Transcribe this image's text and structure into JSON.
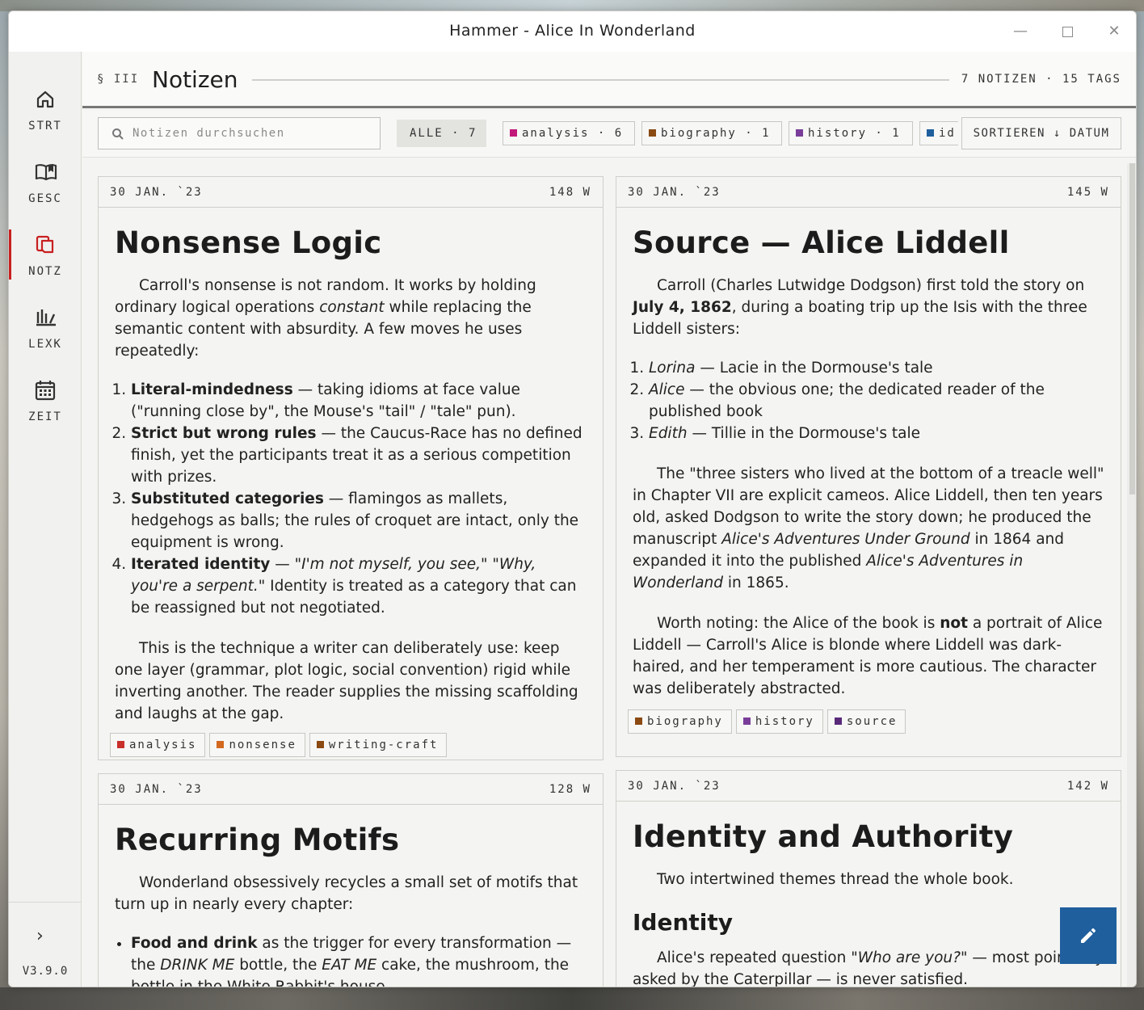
{
  "window": {
    "title": "Hammer - Alice In Wonderland"
  },
  "sidebar": {
    "items": [
      {
        "label": "STRT",
        "icon": "home-icon"
      },
      {
        "label": "GESC",
        "icon": "book-icon"
      },
      {
        "label": "NOTZ",
        "icon": "notes-icon",
        "active": true
      },
      {
        "label": "LEXK",
        "icon": "library-icon"
      },
      {
        "label": "ZEIT",
        "icon": "calendar-icon"
      }
    ],
    "version": "V3.9.0"
  },
  "header": {
    "section": "§ III",
    "title": "Notizen",
    "count": "7 NOTIZEN · 15 TAGS"
  },
  "toolbar": {
    "search_placeholder": "Notizen durchsuchen",
    "filters": [
      {
        "label": "ALLE · 7"
      },
      {
        "label": "analysis · 6",
        "color": "#c2187a"
      },
      {
        "label": "biography · 1",
        "color": "#8a4a12"
      },
      {
        "label": "history · 1",
        "color": "#7a3e9a"
      },
      {
        "label": "id",
        "color": "#1f5f9e"
      }
    ],
    "sort_label": "SORTIEREN ↓ DATUM"
  },
  "notes": [
    {
      "date": "30 JAN. `23",
      "words": "148 W",
      "title": "Nonsense Logic",
      "p1_a": "Carroll's nonsense is not random. It works by holding ordinary logical operations ",
      "p1_em": "constant",
      "p1_b": " while replacing the semantic content with absurdity. A few moves he uses repeatedly:",
      "list": [
        {
          "strong": "Literal-mindedness",
          "text": " — taking idioms at face value (\"running close by\", the Mouse's \"tail\" / \"tale\" pun)."
        },
        {
          "strong": "Strict but wrong rules",
          "text": " — the Caucus-Race has no defined finish, yet the participants treat it as a serious competition with prizes."
        },
        {
          "strong": "Substituted categories",
          "text": " — flamingos as mallets, hedgehogs as balls; the rules of croquet are intact, only the equipment is wrong."
        },
        {
          "strong": "Iterated identity",
          "text_a": " — \"",
          "em": "I'm not myself, you see,",
          "text_b": "\" \"",
          "em2": "Why, you're a serpent.",
          "text_c": "\" Identity is treated as a category that can be reassigned but not negotiated."
        }
      ],
      "p2": "This is the technique a writer can deliberately use: keep one layer (grammar, plot logic, social convention) rigid while inverting another. The reader supplies the missing scaffolding and laughs at the gap.",
      "tags": [
        {
          "label": "analysis",
          "color": "#c8302a"
        },
        {
          "label": "nonsense",
          "color": "#d2691e"
        },
        {
          "label": "writing-craft",
          "color": "#8a4a12"
        }
      ]
    },
    {
      "date": "30 JAN. `23",
      "words": "145 W",
      "title": "Source — Alice Liddell",
      "p1_a": "Carroll (Charles Lutwidge Dodgson) first told the story on ",
      "p1_strong": "July 4, 1862",
      "p1_b": ", during a boating trip up the Isis with the three Liddell sisters:",
      "list": [
        {
          "em": "Lorina",
          "text": " — Lacie in the Dormouse's tale"
        },
        {
          "em": "Alice",
          "text": " — the obvious one; the dedicated reader of the published book"
        },
        {
          "em": "Edith",
          "text": " — Tillie in the Dormouse's tale"
        }
      ],
      "p2_a": "The \"three sisters who lived at the bottom of a treacle well\" in Chapter VII are explicit cameos. Alice Liddell, then ten years old, asked Dodgson to write the story down; he produced the manuscript ",
      "p2_em": "Alice's Adventures Under Ground",
      "p2_b": " in 1864 and expanded it into the published ",
      "p2_em2": "Alice's Adventures in Wonderland",
      "p2_c": " in 1865.",
      "p3_a": "Worth noting: the Alice of the book is ",
      "p3_strong": "not",
      "p3_b": " a portrait of Alice Liddell — Carroll's Alice is blonde where Liddell was dark-haired, and her temperament is more cautious. The character was deliberately abstracted.",
      "tags": [
        {
          "label": "biography",
          "color": "#8a4a12"
        },
        {
          "label": "history",
          "color": "#7a3e9a"
        },
        {
          "label": "source",
          "color": "#5a2a7a"
        }
      ]
    },
    {
      "date": "30 JAN. `23",
      "words": "128 W",
      "title": "Recurring Motifs",
      "p1": "Wonderland obsessively recycles a small set of motifs that turn up in nearly every chapter:",
      "li_strong": "Food and drink",
      "li_a": " as the trigger for every transformation — the ",
      "li_em": "DRINK ME",
      "li_b": " bottle, the ",
      "li_em2": "EAT ME",
      "li_c": " cake, the mushroom, the bottle in the White Rabbit's house."
    },
    {
      "date": "30 JAN. `23",
      "words": "142 W",
      "title": "Identity and Authority",
      "p1": "Two intertwined themes thread the whole book.",
      "subtitle": "Identity",
      "p2_a": "Alice's repeated question \"",
      "p2_em": "Who are you?",
      "p2_b": "\" — most pointedly asked by the Caterpillar — is never satisfied."
    }
  ]
}
